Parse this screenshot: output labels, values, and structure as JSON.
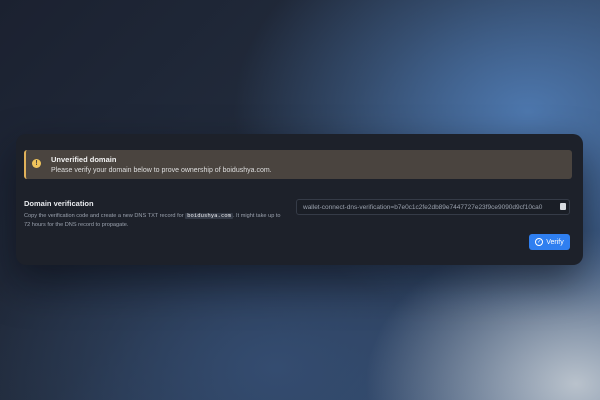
{
  "alert": {
    "title": "Unverified domain",
    "message": "Please verify your domain below to prove ownership of boidushya.com.",
    "icon": "warning-icon",
    "icon_glyph": "!"
  },
  "verification": {
    "title": "Domain verification",
    "desc_before": "Copy the verification code and create a new DNS TXT record for ",
    "domain": "boidushya.com",
    "desc_after": ". It might take up to 72 hours for the DNS record to propagate.",
    "code": "wallet-connect-dns-verification=b7e0c1c2fe2db89e7447727e23f9ce9090d9cf10ca0",
    "copy_icon": "copy-icon"
  },
  "verify_button": {
    "label": "Verify",
    "icon": "check-circle-icon",
    "icon_glyph": "✓",
    "color": "#2f7ff0"
  }
}
